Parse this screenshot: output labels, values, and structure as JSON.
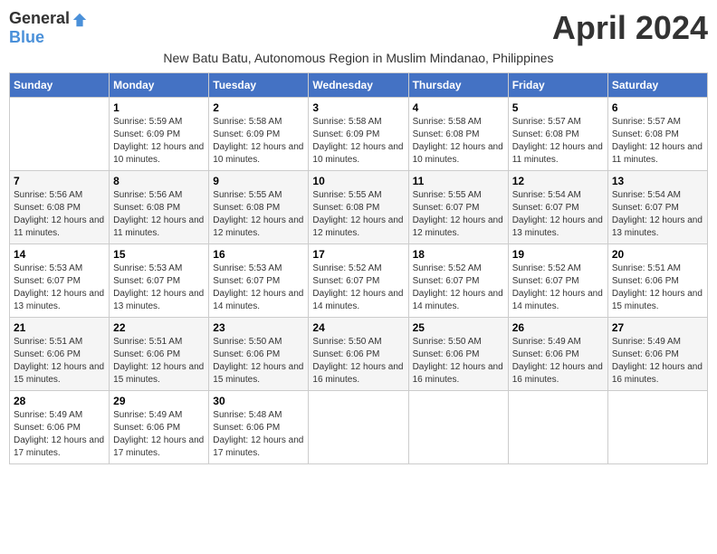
{
  "header": {
    "logo_general": "General",
    "logo_blue": "Blue",
    "month_title": "April 2024",
    "subtitle": "New Batu Batu, Autonomous Region in Muslim Mindanao, Philippines"
  },
  "days_of_week": [
    "Sunday",
    "Monday",
    "Tuesday",
    "Wednesday",
    "Thursday",
    "Friday",
    "Saturday"
  ],
  "weeks": [
    [
      {
        "day": "",
        "sunrise": "",
        "sunset": "",
        "daylight": ""
      },
      {
        "day": "1",
        "sunrise": "Sunrise: 5:59 AM",
        "sunset": "Sunset: 6:09 PM",
        "daylight": "Daylight: 12 hours and 10 minutes."
      },
      {
        "day": "2",
        "sunrise": "Sunrise: 5:58 AM",
        "sunset": "Sunset: 6:09 PM",
        "daylight": "Daylight: 12 hours and 10 minutes."
      },
      {
        "day": "3",
        "sunrise": "Sunrise: 5:58 AM",
        "sunset": "Sunset: 6:09 PM",
        "daylight": "Daylight: 12 hours and 10 minutes."
      },
      {
        "day": "4",
        "sunrise": "Sunrise: 5:58 AM",
        "sunset": "Sunset: 6:08 PM",
        "daylight": "Daylight: 12 hours and 10 minutes."
      },
      {
        "day": "5",
        "sunrise": "Sunrise: 5:57 AM",
        "sunset": "Sunset: 6:08 PM",
        "daylight": "Daylight: 12 hours and 11 minutes."
      },
      {
        "day": "6",
        "sunrise": "Sunrise: 5:57 AM",
        "sunset": "Sunset: 6:08 PM",
        "daylight": "Daylight: 12 hours and 11 minutes."
      }
    ],
    [
      {
        "day": "7",
        "sunrise": "Sunrise: 5:56 AM",
        "sunset": "Sunset: 6:08 PM",
        "daylight": "Daylight: 12 hours and 11 minutes."
      },
      {
        "day": "8",
        "sunrise": "Sunrise: 5:56 AM",
        "sunset": "Sunset: 6:08 PM",
        "daylight": "Daylight: 12 hours and 11 minutes."
      },
      {
        "day": "9",
        "sunrise": "Sunrise: 5:55 AM",
        "sunset": "Sunset: 6:08 PM",
        "daylight": "Daylight: 12 hours and 12 minutes."
      },
      {
        "day": "10",
        "sunrise": "Sunrise: 5:55 AM",
        "sunset": "Sunset: 6:08 PM",
        "daylight": "Daylight: 12 hours and 12 minutes."
      },
      {
        "day": "11",
        "sunrise": "Sunrise: 5:55 AM",
        "sunset": "Sunset: 6:07 PM",
        "daylight": "Daylight: 12 hours and 12 minutes."
      },
      {
        "day": "12",
        "sunrise": "Sunrise: 5:54 AM",
        "sunset": "Sunset: 6:07 PM",
        "daylight": "Daylight: 12 hours and 13 minutes."
      },
      {
        "day": "13",
        "sunrise": "Sunrise: 5:54 AM",
        "sunset": "Sunset: 6:07 PM",
        "daylight": "Daylight: 12 hours and 13 minutes."
      }
    ],
    [
      {
        "day": "14",
        "sunrise": "Sunrise: 5:53 AM",
        "sunset": "Sunset: 6:07 PM",
        "daylight": "Daylight: 12 hours and 13 minutes."
      },
      {
        "day": "15",
        "sunrise": "Sunrise: 5:53 AM",
        "sunset": "Sunset: 6:07 PM",
        "daylight": "Daylight: 12 hours and 13 minutes."
      },
      {
        "day": "16",
        "sunrise": "Sunrise: 5:53 AM",
        "sunset": "Sunset: 6:07 PM",
        "daylight": "Daylight: 12 hours and 14 minutes."
      },
      {
        "day": "17",
        "sunrise": "Sunrise: 5:52 AM",
        "sunset": "Sunset: 6:07 PM",
        "daylight": "Daylight: 12 hours and 14 minutes."
      },
      {
        "day": "18",
        "sunrise": "Sunrise: 5:52 AM",
        "sunset": "Sunset: 6:07 PM",
        "daylight": "Daylight: 12 hours and 14 minutes."
      },
      {
        "day": "19",
        "sunrise": "Sunrise: 5:52 AM",
        "sunset": "Sunset: 6:07 PM",
        "daylight": "Daylight: 12 hours and 14 minutes."
      },
      {
        "day": "20",
        "sunrise": "Sunrise: 5:51 AM",
        "sunset": "Sunset: 6:06 PM",
        "daylight": "Daylight: 12 hours and 15 minutes."
      }
    ],
    [
      {
        "day": "21",
        "sunrise": "Sunrise: 5:51 AM",
        "sunset": "Sunset: 6:06 PM",
        "daylight": "Daylight: 12 hours and 15 minutes."
      },
      {
        "day": "22",
        "sunrise": "Sunrise: 5:51 AM",
        "sunset": "Sunset: 6:06 PM",
        "daylight": "Daylight: 12 hours and 15 minutes."
      },
      {
        "day": "23",
        "sunrise": "Sunrise: 5:50 AM",
        "sunset": "Sunset: 6:06 PM",
        "daylight": "Daylight: 12 hours and 15 minutes."
      },
      {
        "day": "24",
        "sunrise": "Sunrise: 5:50 AM",
        "sunset": "Sunset: 6:06 PM",
        "daylight": "Daylight: 12 hours and 16 minutes."
      },
      {
        "day": "25",
        "sunrise": "Sunrise: 5:50 AM",
        "sunset": "Sunset: 6:06 PM",
        "daylight": "Daylight: 12 hours and 16 minutes."
      },
      {
        "day": "26",
        "sunrise": "Sunrise: 5:49 AM",
        "sunset": "Sunset: 6:06 PM",
        "daylight": "Daylight: 12 hours and 16 minutes."
      },
      {
        "day": "27",
        "sunrise": "Sunrise: 5:49 AM",
        "sunset": "Sunset: 6:06 PM",
        "daylight": "Daylight: 12 hours and 16 minutes."
      }
    ],
    [
      {
        "day": "28",
        "sunrise": "Sunrise: 5:49 AM",
        "sunset": "Sunset: 6:06 PM",
        "daylight": "Daylight: 12 hours and 17 minutes."
      },
      {
        "day": "29",
        "sunrise": "Sunrise: 5:49 AM",
        "sunset": "Sunset: 6:06 PM",
        "daylight": "Daylight: 12 hours and 17 minutes."
      },
      {
        "day": "30",
        "sunrise": "Sunrise: 5:48 AM",
        "sunset": "Sunset: 6:06 PM",
        "daylight": "Daylight: 12 hours and 17 minutes."
      },
      {
        "day": "",
        "sunrise": "",
        "sunset": "",
        "daylight": ""
      },
      {
        "day": "",
        "sunrise": "",
        "sunset": "",
        "daylight": ""
      },
      {
        "day": "",
        "sunrise": "",
        "sunset": "",
        "daylight": ""
      },
      {
        "day": "",
        "sunrise": "",
        "sunset": "",
        "daylight": ""
      }
    ]
  ]
}
